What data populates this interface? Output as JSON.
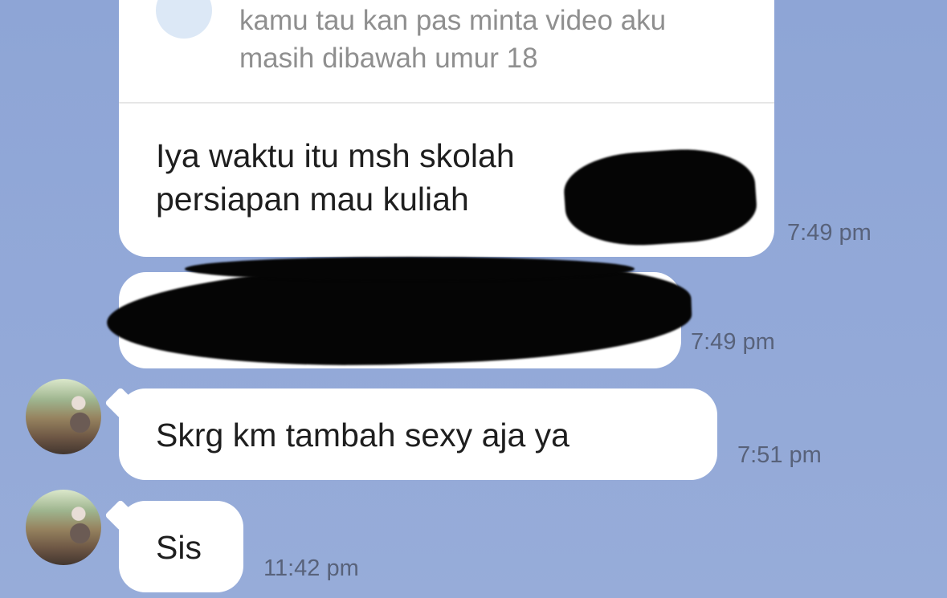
{
  "messages": [
    {
      "quoted_text": "kamu tau kan pas minta video aku\nmasih dibawah umur 18",
      "reply_text": "Iya waktu itu msh skolah\npersiapan mau kuliah",
      "time": "7:49 pm"
    },
    {
      "text": "",
      "time": "7:49 pm"
    },
    {
      "text": "Skrg km tambah sexy aja ya",
      "time": "7:51 pm"
    },
    {
      "text": "Sis",
      "time": "11:42 pm"
    }
  ],
  "colors": {
    "background": "#8fa6d6",
    "bubble": "#ffffff",
    "timestamp": "#58627a",
    "quoted_text": "#8f8f8f"
  }
}
